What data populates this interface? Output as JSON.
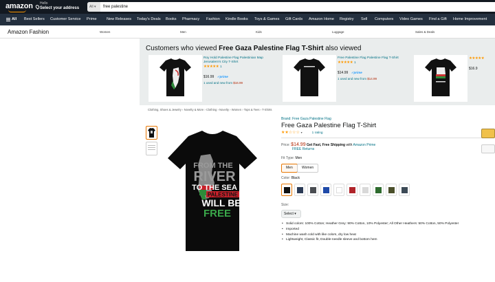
{
  "header": {
    "logo": "amazon",
    "deliver_hello": "Hello",
    "deliver_address": "Select your address",
    "search_category": "All",
    "search_query": "free palestine"
  },
  "nav": {
    "all_label": "All",
    "items": [
      "Best Sellers",
      "Customer Service",
      "Prime",
      "New Releases",
      "Today's Deals",
      "Books",
      "Pharmacy",
      "Fashion",
      "Kindle Books",
      "Toys & Games",
      "Gift Cards",
      "Amazon Home",
      "Registry",
      "Sell",
      "Computers",
      "Video Games",
      "Find a Gift",
      "Home Improvement"
    ]
  },
  "subnav": {
    "brand": "Amazon Fashion",
    "items": [
      "Women",
      "Men",
      "Kids",
      "Luggage",
      "Sales & Deals"
    ]
  },
  "also_viewed": {
    "heading_prefix": "Customers who viewed",
    "heading_bold": "Free Gaza Palestine Flag T-Shirt",
    "heading_suffix": "also viewed",
    "cards": [
      {
        "title": "Roy Hold Palestine Flag Palestinian Map Jerusalem's City T-Shirt",
        "stars": "★★★★★",
        "count": "1",
        "price": "$16.99",
        "prime": "✓prime",
        "used_prefix": "1 used and new from",
        "used_price": "$16.99"
      },
      {
        "title": "Free Palestine Flag Palestine Flag T-Shirt",
        "stars": "★★★★★",
        "count": "1",
        "price": "$14.99",
        "prime": "✓prime",
        "used_prefix": "1 used and new from",
        "used_price": "$14.99"
      },
      {
        "title": "",
        "stars": "★★★★★",
        "count": "",
        "price": "$16.9",
        "prime": "",
        "used_prefix": "",
        "used_price": ""
      }
    ]
  },
  "breadcrumb": "Clothing, Shoes & Jewelry › Novelty & More › Clothing › Novelty › Women › Tops & Tees › T-Shirts",
  "product": {
    "brand_link": "Brand: Free Gaza Palestine Flag",
    "title": "Free Gaza Palestine Flag T-Shirt",
    "stars": "★★☆☆☆",
    "ratings": "1 rating",
    "price_label": "Price:",
    "price": "$14.99",
    "price_shipping": "Get Fast, Free Shipping",
    "price_with": "with",
    "price_prime": "Amazon Prime",
    "free_returns": "FREE Returns",
    "fit_label": "Fit Type:",
    "fit_value": "Men",
    "fit_options": [
      "Men",
      "Women"
    ],
    "color_label": "Color:",
    "color_value": "Black",
    "size_label": "Size:",
    "size_select": "Select",
    "shirt_text": [
      "FROM THE",
      "RIVER",
      "TO THE SEA",
      "PALESTINE",
      "WILL BE",
      "FREE"
    ],
    "bullets": [
      "Solid colors: 100% Cotton; Heather Grey: 90% Cotton, 10% Polyester; All Other Heathers: 50% Cotton, 50% Polyester",
      "Imported",
      "Machine wash cold with like colors, dry low heat",
      "Lightweight, Classic fit, Double-needle sleeve and bottom hem"
    ]
  },
  "swatch_colors": [
    "#111111",
    "#2b3a55",
    "#4a4d52",
    "#1f4aa8",
    "#ffffff",
    "#b0242a",
    "#d9d9d9",
    "#2e6b2e",
    "#4a4f2a",
    "#3c4a56"
  ],
  "colors": {
    "nav_dark": "#131921",
    "nav_mid": "#232f3e",
    "link": "#007185",
    "price_red": "#b12704",
    "star": "#ff9900",
    "selected": "#e77600"
  }
}
